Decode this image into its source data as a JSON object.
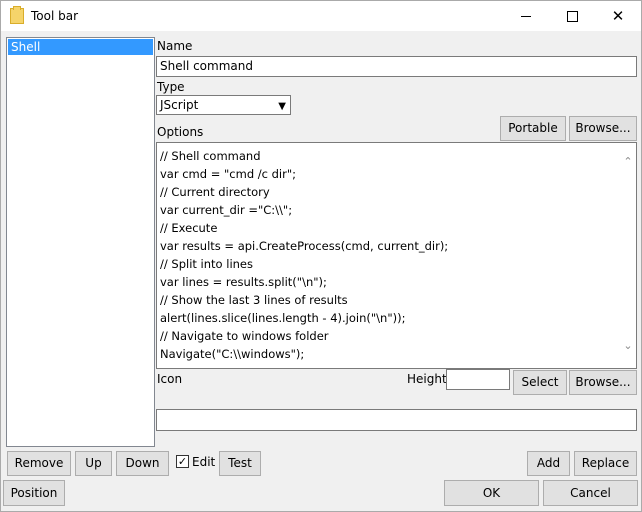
{
  "window": {
    "title": "Tool bar",
    "minimize_glyph": "",
    "close_glyph": "✕"
  },
  "list": {
    "items": [
      "Shell"
    ]
  },
  "form": {
    "name_label": "Name",
    "name_value": "Shell command",
    "type_label": "Type",
    "type_value": "JScript",
    "options_label": "Options",
    "portable_label": "Portable",
    "browse_label": "Browse...",
    "code_lines": [
      "// Shell command",
      "var cmd = \"cmd /c dir\";",
      "// Current directory",
      "var current_dir =\"C:\\\\\";",
      "// Execute",
      "var results = api.CreateProcess(cmd, current_dir);",
      "// Split into lines",
      "var lines = results.split(\"\\n\");",
      "// Show the last 3 lines of results",
      "alert(lines.slice(lines.length - 4).join(\"\\n\"));",
      "// Navigate to windows folder",
      "Navigate(\"C:\\\\windows\");"
    ],
    "icon_label": "Icon",
    "height_label": "Height",
    "height_value": "",
    "select_label": "Select",
    "icon_browse_label": "Browse...",
    "icon_value": ""
  },
  "actions": {
    "remove_label": "Remove",
    "up_label": "Up",
    "down_label": "Down",
    "edit_label": "Edit",
    "edit_checked": true,
    "test_label": "Test",
    "add_label": "Add",
    "replace_label": "Replace"
  },
  "footer": {
    "position_label": "Position",
    "ok_label": "OK",
    "cancel_label": "Cancel"
  }
}
